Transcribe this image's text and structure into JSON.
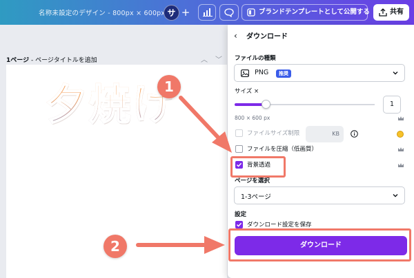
{
  "topbar": {
    "doc_title": "名称未設定のデザイン - 800px × 600px",
    "avatar_initial": "サ",
    "plus": "+",
    "publish_label": "ブランドテンプレートとして公開する",
    "share_label": "共有"
  },
  "canvas": {
    "page_label_bold": "1ページ",
    "page_label_rest": " - ページタイトルを追加",
    "text": "夕焼け"
  },
  "panel": {
    "back": "‹",
    "title": "ダウンロード",
    "file_type_label": "ファイルの種類",
    "file_type_value": "PNG",
    "file_type_badge": "推奨",
    "size_label": "サイズ ×",
    "size_value": "1",
    "size_fraction": 0.22,
    "px_note": "800 × 600 px",
    "limit_label": "ファイルサイズ制限",
    "kb_unit": "KB",
    "compress_label": "ファイルを圧縮（低画質）",
    "transparent_label": "背景透過",
    "pages_label": "ページを選択",
    "pages_value": "1-3ページ",
    "settings_label": "設定",
    "save_settings_label": "ダウンロード設定を保存",
    "download_button": "ダウンロード"
  },
  "annotations": {
    "step1": "1",
    "step2": "2",
    "color": "#f07868"
  },
  "colors": {
    "accent": "#7d2ae8",
    "badge": "#3a5ce9"
  }
}
